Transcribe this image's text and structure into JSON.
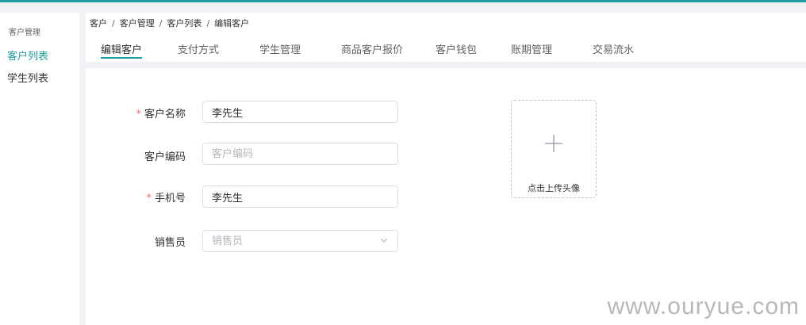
{
  "sidebar": {
    "section_title": "客户管理",
    "items": [
      {
        "label": "客户列表",
        "active": true
      },
      {
        "label": "学生列表",
        "active": false
      }
    ]
  },
  "breadcrumb": [
    "客户",
    "客户管理",
    "客户列表",
    "编辑客户"
  ],
  "breadcrumb_separator": "/",
  "tabs": [
    {
      "label": "编辑客户",
      "active": true
    },
    {
      "label": "支付方式"
    },
    {
      "label": "学生管理"
    },
    {
      "label": "商品客户报价"
    },
    {
      "label": "客户钱包"
    },
    {
      "label": "账期管理"
    },
    {
      "label": "交易流水"
    }
  ],
  "form": {
    "required_mark": "*",
    "fields": {
      "customer_name": {
        "label": "客户名称",
        "value": "李先生",
        "placeholder": ""
      },
      "customer_code": {
        "label": "客户编码",
        "value": "",
        "placeholder": "客户编码"
      },
      "phone": {
        "label": "手机号",
        "value": "李先生",
        "placeholder": ""
      },
      "salesperson": {
        "label": "销售员",
        "value": "",
        "placeholder": "销售员"
      }
    }
  },
  "upload": {
    "label": "点击上传头像"
  },
  "watermark": "www.ouryue.com",
  "colors": {
    "accent": "#1fa0a0",
    "required": "#f56c6c"
  }
}
